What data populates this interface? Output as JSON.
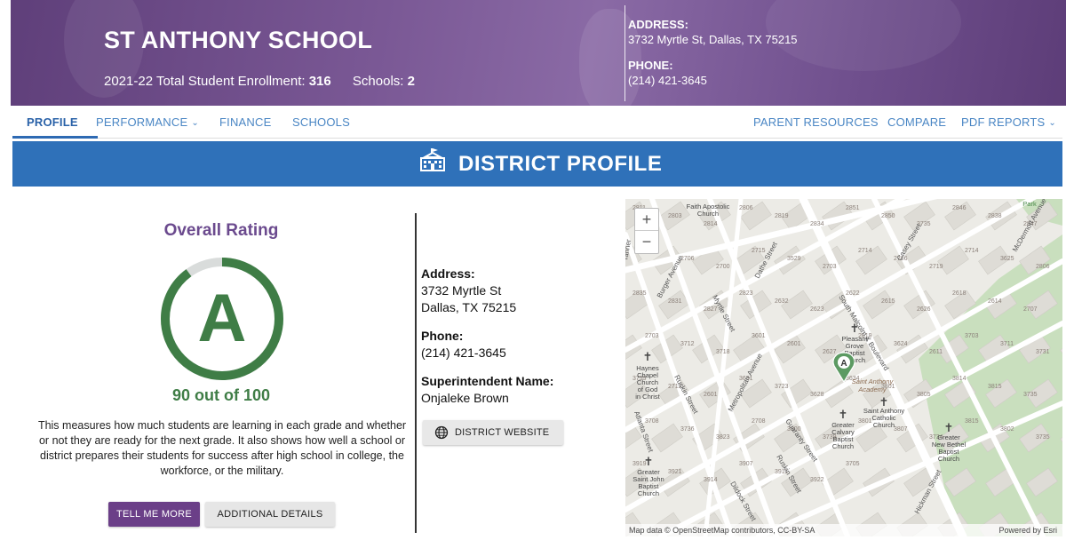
{
  "header": {
    "school_name": "ST ANTHONY SCHOOL",
    "enrollment_label": "2021-22 Total Student Enrollment:",
    "enrollment_value": "316",
    "schools_label": "Schools:",
    "schools_value": "2",
    "address_label": "ADDRESS:",
    "address_value": "3732 Myrtle St, Dallas, TX 75215",
    "phone_label": "PHONE:",
    "phone_value": "(214) 421-3645"
  },
  "nav": {
    "profile": "PROFILE",
    "performance": "PERFORMANCE",
    "finance": "FINANCE",
    "schools": "SCHOOLS",
    "parent_resources": "PARENT RESOURCES",
    "compare": "COMPARE",
    "pdf_reports": "PDF REPORTS",
    "active": "PROFILE"
  },
  "section": {
    "title": "DISTRICT PROFILE",
    "icon": "school-building-icon"
  },
  "rating": {
    "title": "Overall Rating",
    "grade": "A",
    "score_text": "90 out of 100",
    "score": 90,
    "max": 100,
    "description": "This measures how much students are learning in each grade and whether or not they are ready for the next grade. It also shows how well a school or district prepares their students for success after high school in college, the workforce, or the military.",
    "tell_me_more": "TELL ME MORE",
    "additional_details": "ADDITIONAL DETAILS",
    "ring_color": "#3f7d46",
    "ring_track_color": "#d9dcdb"
  },
  "details": {
    "address_label": "Address:",
    "address_line1": "3732 Myrtle St",
    "address_line2": "Dallas, TX 75215",
    "phone_label": "Phone:",
    "phone_value": "(214) 421-3645",
    "superintendent_label": "Superintendent Name:",
    "superintendent_value": "Onjaleke Brown",
    "website_button": "DISTRICT WEBSITE",
    "website_icon": "globe-icon"
  },
  "map": {
    "zoom_in": "+",
    "zoom_out": "−",
    "marker_label": "A",
    "attribution": "Map data © OpenStreetMap contributors, CC-BY-SA",
    "powered_by": "Powered by Esri",
    "street_labels": [
      "Burger Avenue",
      "Myrtle Street",
      "Dathe Street",
      "South Malcolm X Boulevard",
      "Casey Street",
      "McDermott Avenue",
      "Ruskin Street",
      "Metropolitan Avenue",
      "Guaranty Street",
      "Atlanta Street",
      "Dildock Street",
      "Hickman Street",
      "Ruskin Street",
      "Tanner"
    ],
    "poi_labels": [
      "Faith Apostolic Church",
      "Pleasant Grove Baptist Church",
      "Saint Anthony Academy",
      "Saint Anthony Catholic Church",
      "Greater Calvary Baptist Church",
      "Greater New Bethel Baptist Church",
      "Haynes Chapel Church of God in Christ",
      "Greater Saint John Baptist Church",
      "Park"
    ],
    "house_numbers": [
      "2811",
      "2803",
      "2814",
      "2806",
      "2819",
      "2834",
      "2851",
      "2850",
      "3735",
      "2846",
      "2838",
      "2847",
      "2841",
      "2706",
      "2700",
      "2715",
      "3529",
      "2703",
      "2714",
      "2706",
      "2719",
      "2714",
      "3625",
      "2806",
      "2835",
      "2831",
      "2827",
      "2823",
      "2632",
      "2623",
      "2622",
      "2615",
      "2626",
      "2618",
      "2614",
      "2707",
      "2703",
      "3712",
      "3718",
      "3601",
      "2601",
      "2627",
      "2619",
      "3624",
      "2611",
      "3703",
      "3711",
      "3731",
      "3739",
      "2712",
      "2601",
      "3631",
      "3723",
      "3628",
      "3634",
      "3801",
      "3805",
      "3814",
      "3815",
      "3735",
      "3708",
      "3736",
      "3823",
      "2708",
      "3900",
      "3739",
      "3801",
      "3807",
      "3734",
      "3815",
      "3802",
      "3735",
      "3919",
      "3921",
      "3914",
      "3907",
      "3911",
      "3922",
      "3705"
    ]
  }
}
